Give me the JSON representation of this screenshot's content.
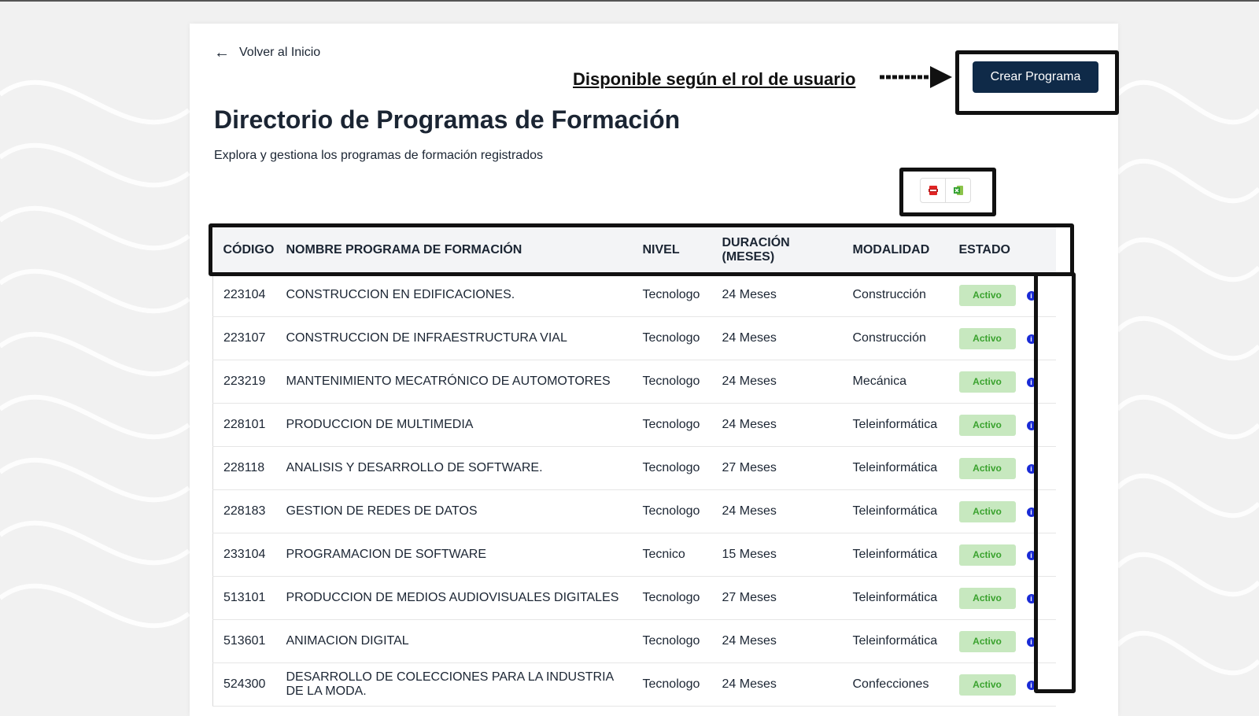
{
  "header": {
    "back_label": "Volver al Inicio",
    "title": "Directorio de Programas de Formación",
    "subtitle": "Explora y gestiona los programas de formación registrados"
  },
  "annotation": {
    "note": "Disponible según el rol de usuario"
  },
  "actions": {
    "create_label": "Crear Programa"
  },
  "export": {
    "pdf_icon": "pdf-file-icon",
    "excel_icon": "excel-file-icon"
  },
  "table": {
    "columns": [
      "CÓDIGO",
      "NOMBRE PROGRAMA DE FORMACIÓN",
      "NIVEL",
      "DURACIÓN (MESES)",
      "MODALIDAD",
      "ESTADO"
    ],
    "rows": [
      {
        "codigo": "223104",
        "nombre": "CONSTRUCCION EN EDIFICACIONES.",
        "nivel": "Tecnologo",
        "duracion": "24 Meses",
        "modalidad": "Construcción",
        "estado": "Activo"
      },
      {
        "codigo": "223107",
        "nombre": "CONSTRUCCION DE INFRAESTRUCTURA VIAL",
        "nivel": "Tecnologo",
        "duracion": "24 Meses",
        "modalidad": "Construcción",
        "estado": "Activo"
      },
      {
        "codigo": "223219",
        "nombre": "MANTENIMIENTO MECATRÓNICO DE AUTOMOTORES",
        "nivel": "Tecnologo",
        "duracion": "24 Meses",
        "modalidad": "Mecánica",
        "estado": "Activo"
      },
      {
        "codigo": "228101",
        "nombre": "PRODUCCION DE MULTIMEDIA",
        "nivel": "Tecnologo",
        "duracion": "24 Meses",
        "modalidad": "Teleinformática",
        "estado": "Activo"
      },
      {
        "codigo": "228118",
        "nombre": "ANALISIS Y DESARROLLO DE SOFTWARE.",
        "nivel": "Tecnologo",
        "duracion": "27 Meses",
        "modalidad": "Teleinformática",
        "estado": "Activo"
      },
      {
        "codigo": "228183",
        "nombre": "GESTION DE REDES DE DATOS",
        "nivel": "Tecnologo",
        "duracion": "24 Meses",
        "modalidad": "Teleinformática",
        "estado": "Activo"
      },
      {
        "codigo": "233104",
        "nombre": "PROGRAMACION DE SOFTWARE",
        "nivel": "Tecnico",
        "duracion": "15 Meses",
        "modalidad": "Teleinformática",
        "estado": "Activo"
      },
      {
        "codigo": "513101",
        "nombre": "PRODUCCION DE MEDIOS AUDIOVISUALES DIGITALES",
        "nivel": "Tecnologo",
        "duracion": "27 Meses",
        "modalidad": "Teleinformática",
        "estado": "Activo"
      },
      {
        "codigo": "513601",
        "nombre": "ANIMACION DIGITAL",
        "nivel": "Tecnologo",
        "duracion": "24 Meses",
        "modalidad": "Teleinformática",
        "estado": "Activo"
      },
      {
        "codigo": "524300",
        "nombre": "DESARROLLO DE COLECCIONES PARA LA INDUSTRIA DE LA MODA.",
        "nivel": "Tecnologo",
        "duracion": "24 Meses",
        "modalidad": "Confecciones",
        "estado": "Activo"
      }
    ],
    "info_icon": "info-icon",
    "info_glyph": "i"
  },
  "colors": {
    "primary": "#0f2a48",
    "badge_bg": "#c7e8bf",
    "badge_text": "#3aa22e",
    "info": "#1a2bd6"
  }
}
